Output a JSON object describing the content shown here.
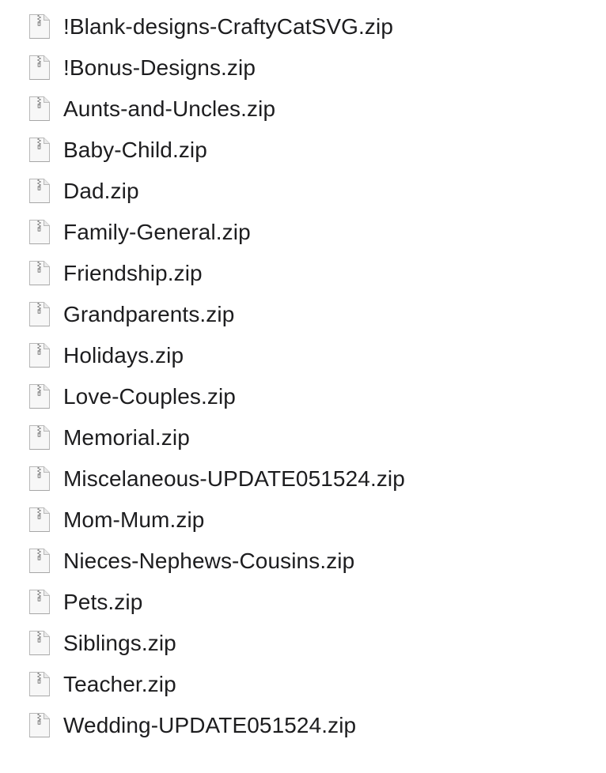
{
  "file_list": {
    "icon": "zip-archive-icon",
    "items": [
      {
        "name": "!Blank-designs-CraftyCatSVG.zip"
      },
      {
        "name": "!Bonus-Designs.zip"
      },
      {
        "name": "Aunts-and-Uncles.zip"
      },
      {
        "name": "Baby-Child.zip"
      },
      {
        "name": "Dad.zip"
      },
      {
        "name": "Family-General.zip"
      },
      {
        "name": "Friendship.zip"
      },
      {
        "name": "Grandparents.zip"
      },
      {
        "name": "Holidays.zip"
      },
      {
        "name": "Love-Couples.zip"
      },
      {
        "name": "Memorial.zip"
      },
      {
        "name": "Miscelaneous-UPDATE051524.zip"
      },
      {
        "name": "Mom-Mum.zip"
      },
      {
        "name": "Nieces-Nephews-Cousins.zip"
      },
      {
        "name": "Pets.zip"
      },
      {
        "name": "Siblings.zip"
      },
      {
        "name": "Teacher.zip"
      },
      {
        "name": "Wedding-UPDATE051524.zip"
      }
    ]
  }
}
